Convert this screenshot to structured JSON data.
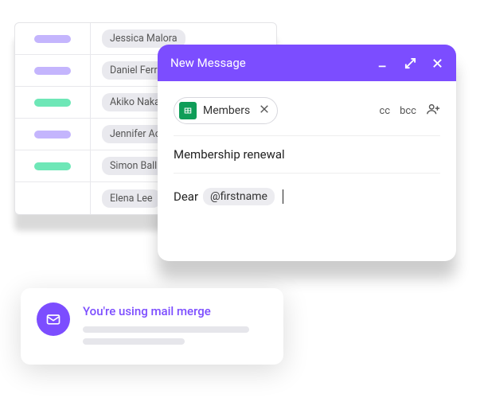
{
  "colors": {
    "accent": "#7c4dff",
    "pill_purple": "#c4b5fd",
    "pill_green": "#6ee7b7",
    "sheets_green": "#0f9d58"
  },
  "sheet": {
    "rows": [
      {
        "tagColor": "purple",
        "name": "Jessica Malora"
      },
      {
        "tagColor": "purple",
        "name": "Daniel Ferr"
      },
      {
        "tagColor": "green",
        "name": "Akiko Naka"
      },
      {
        "tagColor": "purple",
        "name": "Jennifer Ac"
      },
      {
        "tagColor": "green",
        "name": "Simon Balli"
      },
      {
        "tagColor": "",
        "name": "Elena Lee"
      }
    ]
  },
  "compose": {
    "title": "New Message",
    "recipient_chip": {
      "label": "Members"
    },
    "cc_label": "cc",
    "bcc_label": "bcc",
    "subject": "Membership renewal",
    "body_greeting": "Dear",
    "body_variable": "@firstname"
  },
  "toast": {
    "title": "You're using mail merge"
  }
}
